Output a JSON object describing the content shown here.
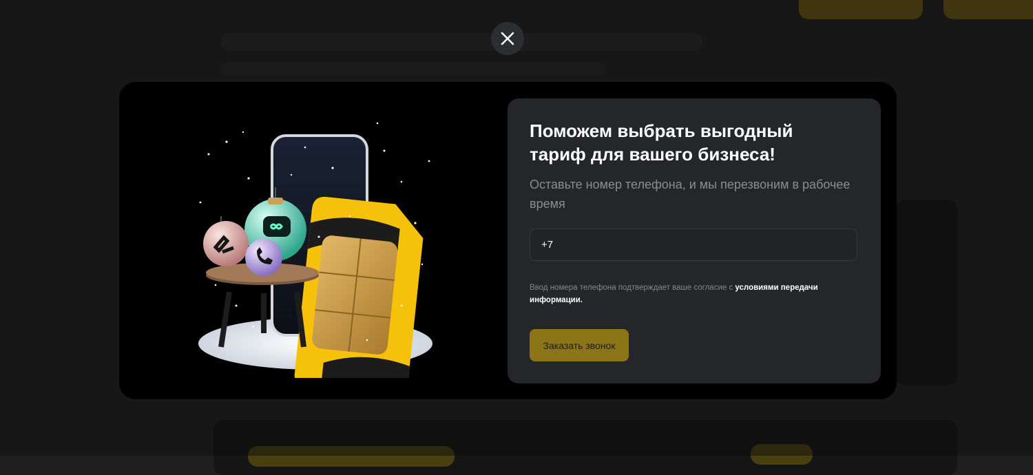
{
  "colors": {
    "modal_background": "#000000",
    "card_background": "#242629",
    "accent_yellow": "#8c7518",
    "text_primary": "#ffffff",
    "text_secondary": "#8a8c90"
  },
  "close_button": {
    "icon": "close-icon"
  },
  "illustration": {
    "icon": "sim-card-phone-christmas-illustration"
  },
  "form": {
    "title": "Поможем выбрать выгодный тариф для вашего бизнеса!",
    "subtitle": "Оставьте номер телефона, и мы перезвоним в рабочее время",
    "phone": {
      "value": "+7",
      "placeholder": ""
    },
    "consent_text": "Ввод номера телефона подтверждает ваше согласие с ",
    "consent_link": "условиями передачи информации.",
    "submit_label": "Заказать звонок"
  }
}
